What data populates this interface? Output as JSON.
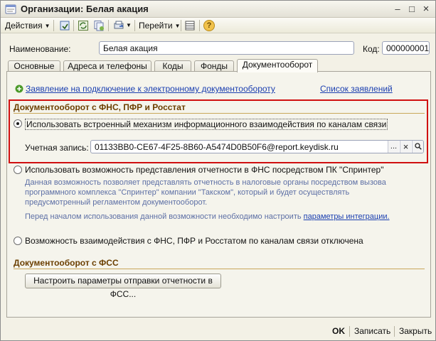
{
  "window": {
    "title": "Организации: Белая акация",
    "minimize": "–",
    "maximize": "□",
    "close": "×"
  },
  "toolbar": {
    "actions_label": "Действия",
    "goto_label": "Перейти",
    "help_label": "?"
  },
  "form": {
    "name_label": "Наименование:",
    "name_value": "Белая акация",
    "code_label": "Код:",
    "code_value": "000000001"
  },
  "tabs": [
    {
      "label": "Основные"
    },
    {
      "label": "Адреса и телефоны"
    },
    {
      "label": "Коды"
    },
    {
      "label": "Фонды"
    },
    {
      "label": "Документооборот"
    }
  ],
  "active_tab": "Документооборот",
  "docflow": {
    "connect_link": "Заявление на подключение к электронному документообороту",
    "requests_link": "Список заявлений",
    "fns_section_title": "Документооборот с ФНС, ПФР и Росстат",
    "option1": "Использовать встроенный механизм информационного взаимодействия по каналам связи",
    "account_label": "Учетная запись:",
    "account_value": "01133BB0-CE67-4F25-8B60-A5474D0B50F6@report.keydisk.ru",
    "account_btn_select": "...",
    "account_btn_clear": "×",
    "option2": "Использовать возможность представления отчетности в ФНС посредством ПК \"Спринтер\"",
    "option2_desc_1": "Данная возможность позволяет представлять отчетность в налоговые органы посредством вызова",
    "option2_desc_2": "программного комплекса \"Спринтер\" компании \"Такском\", который и будет осуществлять",
    "option2_desc_3": "предусмотренный регламентом документооборот.",
    "option2_note": "Перед началом использования данной возможности необходимо настроить",
    "option2_note_link": "параметры интеграции.",
    "option3": "Возможность взаимодействия с ФНС, ПФР и Росстатом по каналам связи отключена",
    "fss_section_title": "Документооборот с ФСС",
    "fss_button": "Настроить параметры отправки отчетности в ФСС..."
  },
  "bottom": {
    "ok": "OK",
    "save": "Записать",
    "close": "Закрыть"
  }
}
